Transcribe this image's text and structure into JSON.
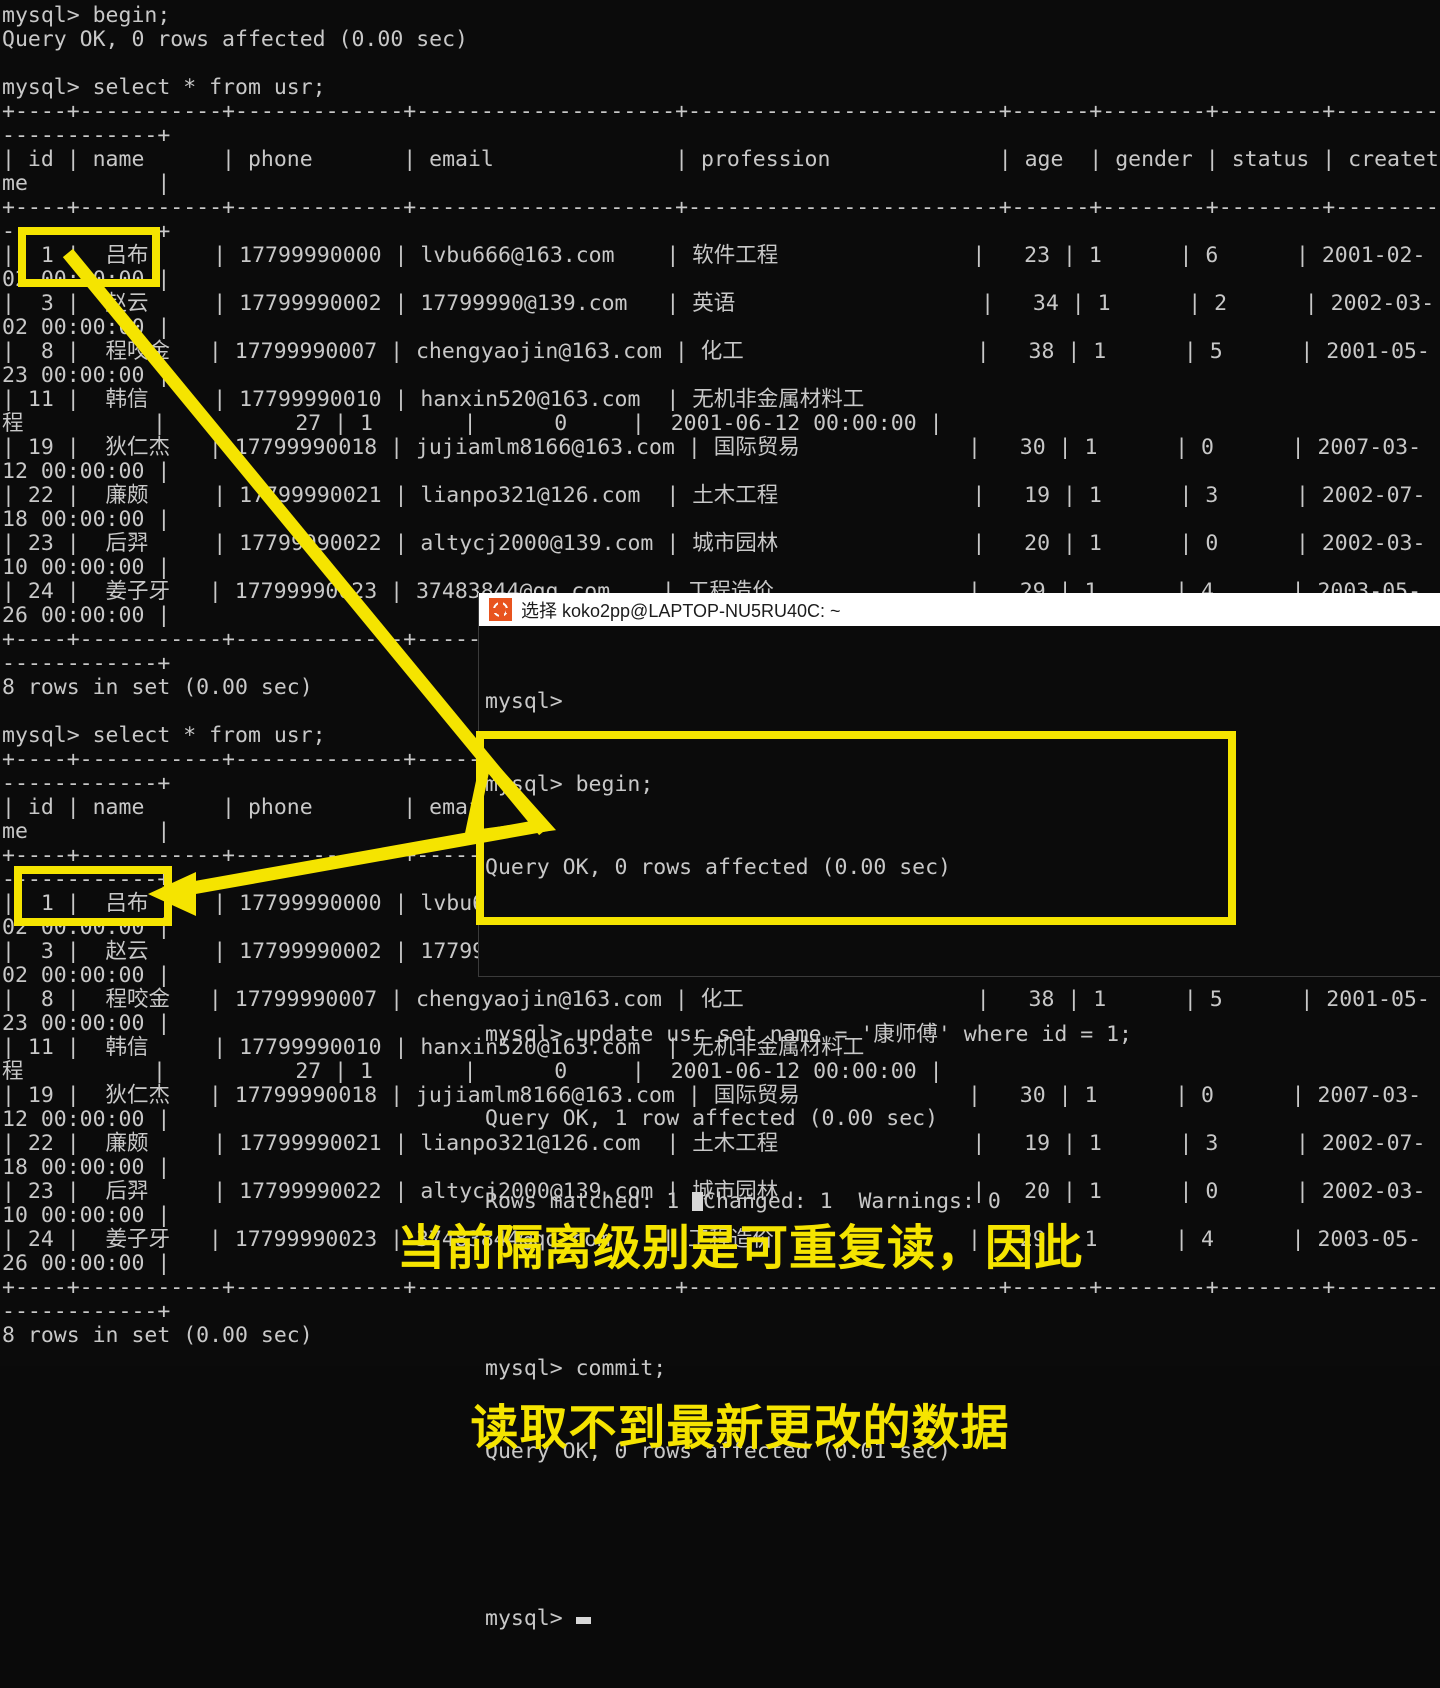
{
  "main_terminal": {
    "name": "mysql-cli-background",
    "lines": [
      "mysql> begin;",
      "Query OK, 0 rows affected (0.00 sec)",
      "",
      "mysql> select * from usr;",
      "+----+-----------+-------------+--------------------+------------------------+------+--------+--------+--------",
      "------------+",
      "| id | name      | phone       | email              | profession             | age  | gender | status | createti",
      "me          |",
      "+----+-----------+-------------+--------------------+------------------------+------+--------+--------+--------",
      "------------+",
      "|  1 |  吕布     | 17799990000 | lvbu666@163.com    | 软件工程               |   23 | 1      | 6      | 2001-02-",
      "02 00:00:00 |",
      "|  3 |  赵云     | 17799990002 | 17799990@139.com   | 英语                   |   34 | 1      | 2      | 2002-03-",
      "02 00:00:00 |",
      "|  8 |  程咬金   | 17799990007 | chengyaojin@163.com | 化工                  |   38 | 1      | 5      | 2001-05-",
      "23 00:00:00 |",
      "| 11 |  韩信     | 17799990010 | hanxin520@163.com  | 无机非金属材料工",
      "程          |          27 | 1       |      0     |  2001-06-12 00:00:00 |",
      "| 19 |  狄仁杰   | 17799990018 | jujiamlm8166@163.com | 国际贸易             |   30 | 1      | 0      | 2007-03-",
      "12 00:00:00 |",
      "| 22 |  廉颇     | 17799990021 | lianpo321@126.com  | 土木工程               |   19 | 1      | 3      | 2002-07-",
      "18 00:00:00 |",
      "| 23 |  后羿     | 17799990022 | altycj2000@139.com | 城市园林               |   20 | 1      | 0      | 2002-03-",
      "10 00:00:00 |",
      "| 24 |  姜子牙   | 17799990023 | 37483844@qq.com    | 工程造价               |   29 | 1      | 4      | 2003-05-",
      "26 00:00:00 |",
      "+----+-----------+-------------+--------------------+------------------------+------+--------+--------+--------",
      "------------+",
      "8 rows in set (0.00 sec)",
      "",
      "mysql> select * from usr;",
      "+----+-----------+-------------+--------------------+------------------------+------+--------+--------+--------",
      "------------+",
      "| id | name      | phone       | email              | profession             | age  | gender | status | createti",
      "me          |",
      "+----+-----------+-------------+--------------------+------------------------+------+--------+--------+--------",
      "------------+",
      "|  1 |  吕布     | 17799990000 | lvbu666@163.com    | 软件工程               |   23 | 1      | 6      | 2001-02-",
      "02 00:00:00 |",
      "|  3 |  赵云     | 17799990002 | 17799990@139.com   | 英语                   |   34 | 1      | 2      | 2002-03-",
      "02 00:00:00 |",
      "|  8 |  程咬金   | 17799990007 | chengyaojin@163.com | 化工                  |   38 | 1      | 5      | 2001-05-",
      "23 00:00:00 |",
      "| 11 |  韩信     | 17799990010 | hanxin520@163.com  | 无机非金属材料工",
      "程          |          27 | 1       |      0     |  2001-06-12 00:00:00 |",
      "| 19 |  狄仁杰   | 17799990018 | jujiamlm8166@163.com | 国际贸易             |   30 | 1      | 0      | 2007-03-",
      "12 00:00:00 |",
      "| 22 |  廉颇     | 17799990021 | lianpo321@126.com  | 土木工程               |   19 | 1      | 3      | 2002-07-",
      "18 00:00:00 |",
      "| 23 |  后羿     | 17799990022 | altycj2000@139.com | 城市园林               |   20 | 1      | 0      | 2002-03-",
      "10 00:00:00 |",
      "| 24 |  姜子牙   | 17799990023 | 37483844@qq.com    | 工程造价               |   29 | 1      | 4      | 2003-05-",
      "26 00:00:00 |",
      "+----+-----------+-------------+--------------------+------------------------+------+--------+--------+--------",
      "------------+",
      "8 rows in set (0.00 sec)"
    ],
    "table": {
      "type": "table",
      "columns": [
        "id",
        "name",
        "phone",
        "email",
        "profession",
        "age",
        "gender",
        "status",
        "createtime"
      ],
      "rows": [
        [
          "1",
          "吕布",
          "17799990000",
          "lvbu666@163.com",
          "软件工程",
          "23",
          "1",
          "6",
          "2001-02-02 00:00:00"
        ],
        [
          "3",
          "赵云",
          "17799990002",
          "17799990@139.com",
          "英语",
          "34",
          "1",
          "2",
          "2002-03-02 00:00:00"
        ],
        [
          "8",
          "程咬金",
          "17799990007",
          "chengyaojin@163.com",
          "化工",
          "38",
          "1",
          "5",
          "2001-05-23 00:00:00"
        ],
        [
          "11",
          "韩信",
          "17799990010",
          "hanxin520@163.com",
          "无机非金属材料工程",
          "27",
          "1",
          "0",
          "2001-06-12 00:00:00"
        ],
        [
          "19",
          "狄仁杰",
          "17799990018",
          "jujiamlm8166@163.com",
          "国际贸易",
          "30",
          "1",
          "0",
          "2007-03-12 00:00:00"
        ],
        [
          "22",
          "廉颇",
          "17799990021",
          "lianpo321@126.com",
          "土木工程",
          "19",
          "1",
          "3",
          "2002-07-18 00:00:00"
        ],
        [
          "23",
          "后羿",
          "17799990022",
          "altycj2000@139.com",
          "城市园林",
          "20",
          "1",
          "0",
          "2002-03-10 00:00:00"
        ],
        [
          "24",
          "姜子牙",
          "17799990023",
          "37483844@qq.com",
          "工程造价",
          "29",
          "1",
          "4",
          "2003-05-26 00:00:00"
        ]
      ],
      "row_count_text": "8 rows in set (0.00 sec)"
    }
  },
  "popup": {
    "title": "选择 koko2pp@LAPTOP-NU5RU40C: ~",
    "icon": "ubuntu-icon",
    "lines": [
      "mysql>",
      "mysql> begin;",
      "Query OK, 0 rows affected (0.00 sec)",
      "",
      "mysql> update usr set name = '康师傅' where id = 1;",
      "Query OK, 1 row affected (0.00 sec)",
      "Rows matched: 1  Changed: 1  Warnings: 0",
      "",
      "mysql> commit;",
      "Query OK, 0 rows affected (0.01 sec)",
      "",
      "mysql>"
    ],
    "line_a": "mysql>",
    "line_b": "mysql> begin;",
    "line_c": "Query OK, 0 rows affected (0.00 sec)",
    "line_update": "mysql> update usr set name = '康师傅' where id = 1;",
    "line_update_ok": "Query OK, 1 row affected (0.00 sec)",
    "line_rows_pre": "Rows matched: 1 ",
    "line_rows_post": "Changed: 1  Warnings: 0",
    "line_commit": "mysql> commit;",
    "line_commit_ok": "Query OK, 0 rows affected (0.01 sec)",
    "line_prompt": "mysql> "
  },
  "annotation": {
    "line1": "当前隔离级别是可重复读，因此",
    "line2": "读取不到最新更改的数据",
    "color": "#f5e400"
  },
  "highlights": {
    "top_box_label": "吕布 row id 1 before update",
    "bottom_box_label": "吕布 row id 1 after commit",
    "popup_box_label": "update and commit statements"
  },
  "colors": {
    "terminal_background": "#0b0b0b",
    "terminal_text": "#c8c8c8",
    "accent_yellow": "#f5e400",
    "titlebar_background": "#ffffff",
    "titlebar_text": "#1c1c1c",
    "ubuntu_orange": "#e8541f"
  }
}
